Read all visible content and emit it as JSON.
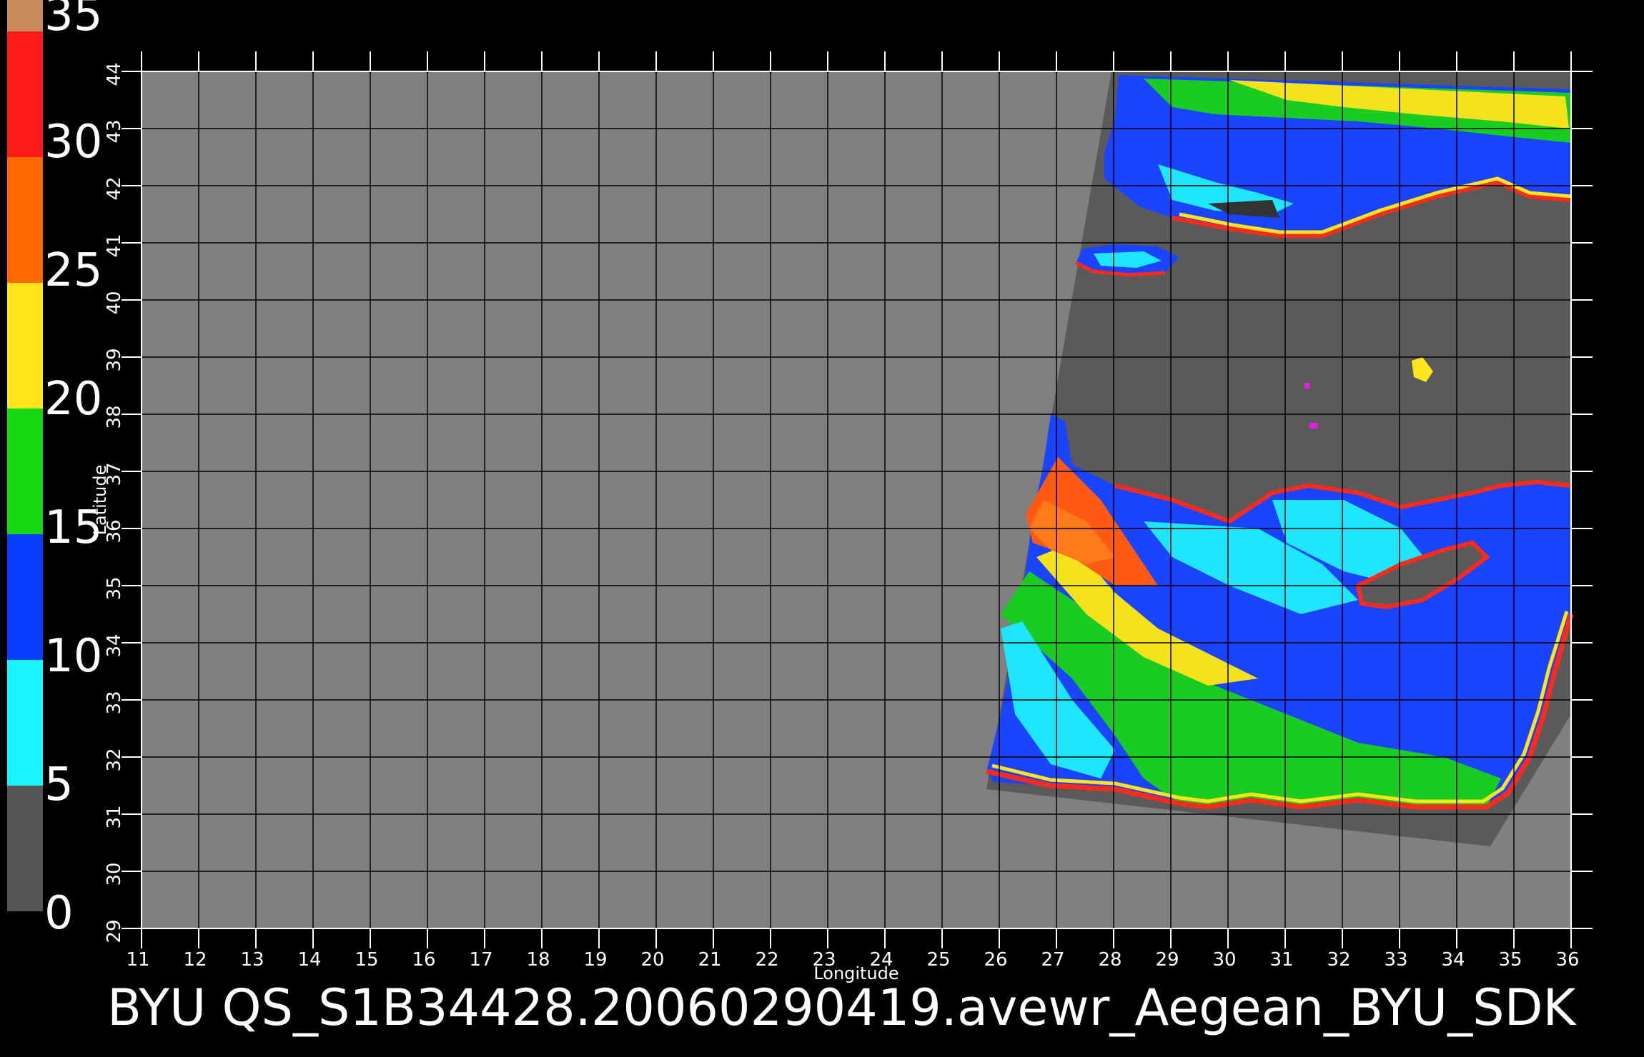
{
  "colorbar": {
    "labels": [
      "35",
      "30",
      "25",
      "20",
      "15",
      "10",
      "5",
      "0"
    ],
    "stops": [
      "#c88a5a",
      "#ff1a1a",
      "#ff6a00",
      "#ffe51a",
      "#14d814",
      "#0a3cff",
      "#19f2ff",
      "#555555"
    ]
  },
  "axes": {
    "x_title": "Longitude",
    "y_title": "Latitude",
    "x_ticks": [
      "11",
      "12",
      "13",
      "14",
      "15",
      "16",
      "17",
      "18",
      "19",
      "20",
      "21",
      "22",
      "23",
      "24",
      "25",
      "26",
      "27",
      "28",
      "29",
      "30",
      "31",
      "32",
      "33",
      "34",
      "35",
      "36"
    ],
    "y_ticks": [
      "44",
      "43",
      "42",
      "41",
      "40",
      "39",
      "38",
      "37",
      "36",
      "35",
      "34",
      "33",
      "32",
      "31",
      "30",
      "29"
    ]
  },
  "footer_text": "BYU  QS_S1B34428.20060290419.avewr_Aegean_BYU_SDK",
  "colors": {
    "background": "#000000",
    "plot_area": "#808080",
    "swath_land": "#5a5a5a",
    "grid": "#000000",
    "text": "#ffffff"
  }
}
